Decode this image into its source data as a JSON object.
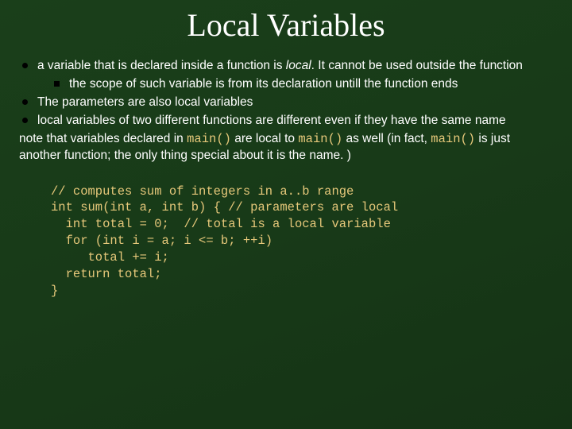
{
  "title": "Local Variables",
  "bullets": {
    "b1_pre": "a variable that is declared inside a function is ",
    "b1_em": "local",
    "b1_post": ". It cannot be used outside the function",
    "b1_sub": "the scope of such variable is from its declaration untill the function ends",
    "b2": "The parameters are also local variables",
    "b3": "local variables of two different functions are different even if they have the same name"
  },
  "note": {
    "pre": "note that variables declared in ",
    "m1": "main()",
    "mid1": " are local to ",
    "m2": "main()",
    "mid2": " as well (in fact, ",
    "m3": "main()",
    "post": " is just another function; the only thing special about it is the name. )"
  },
  "code": "// computes sum of integers in a..b range\nint sum(int a, int b) { // parameters are local\n  int total = 0;  // total is a local variable\n  for (int i = a; i <= b; ++i)\n     total += i;\n  return total;\n}"
}
